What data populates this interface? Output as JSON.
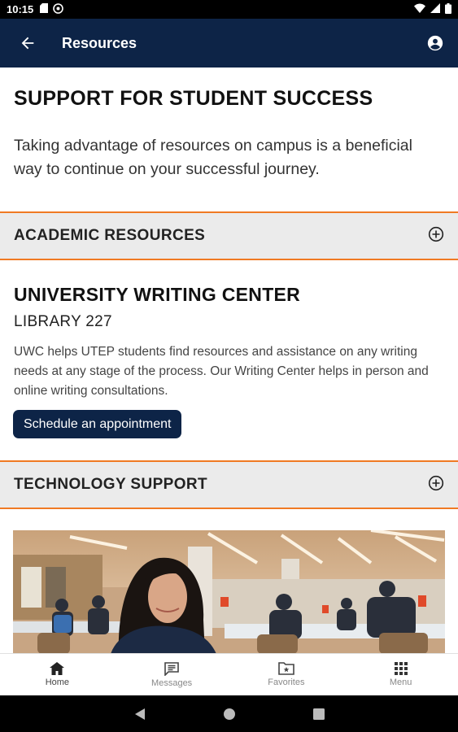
{
  "status_bar": {
    "time": "10:15",
    "icons_left": [
      "sd-card-icon",
      "at-sign-icon"
    ],
    "icons_right": [
      "wifi-icon",
      "signal-icon",
      "battery-icon"
    ]
  },
  "app_bar": {
    "title": "Resources",
    "color": "#0d2447"
  },
  "page": {
    "heading": "SUPPORT FOR STUDENT SUCCESS",
    "intro": "Taking advantage of resources on campus is a beneficial way to continue on your successful journey."
  },
  "sections": [
    {
      "label": "ACADEMIC RESOURCES",
      "expanded": false
    },
    {
      "label": "TECHNOLOGY SUPPORT",
      "expanded": false
    }
  ],
  "writing_center": {
    "title": "UNIVERSITY WRITING CENTER",
    "location": "LIBRARY 227",
    "description": "UWC helps UTEP students find resources and assistance on any writing needs at any stage of the process. Our Writing Center helps in person and online writing consultations.",
    "button_label": "Schedule an appointment"
  },
  "accent_color": "#f07a23",
  "bottom_nav": {
    "items": [
      {
        "label": "Home",
        "icon": "home-icon",
        "active": true
      },
      {
        "label": "Messages",
        "icon": "message-icon",
        "active": false
      },
      {
        "label": "Favorites",
        "icon": "folder-star-icon",
        "active": false
      },
      {
        "label": "Menu",
        "icon": "grid-icon",
        "active": false
      }
    ]
  }
}
